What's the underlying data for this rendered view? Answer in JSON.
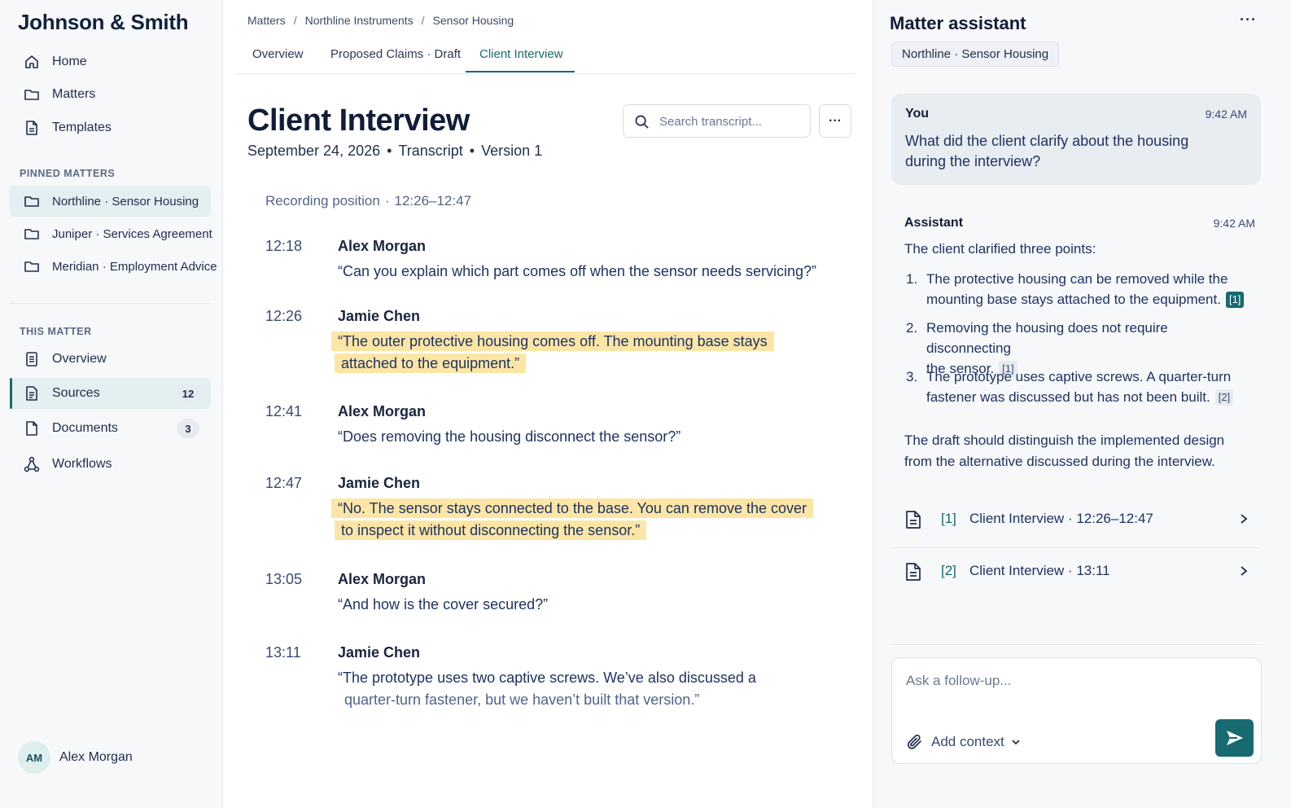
{
  "sidebar": {
    "brand": "Johnson & Smith",
    "nav": [
      {
        "label": "Home",
        "icon": "home-icon"
      },
      {
        "label": "Matters",
        "icon": "folder-icon"
      },
      {
        "label": "Templates",
        "icon": "document-icon"
      }
    ],
    "pinned_heading": "PINNED MATTERS",
    "pinned": [
      {
        "label": "Northline · Sensor Housing",
        "icon": "folder-icon",
        "selected": true
      },
      {
        "label": "Juniper · Services Agreement",
        "icon": "folder-icon"
      },
      {
        "label": "Meridian · Employment Advice",
        "icon": "folder-icon"
      }
    ],
    "matter_heading": "THIS MATTER",
    "matter_nav": [
      {
        "label": "Overview",
        "icon": "list-document-icon"
      },
      {
        "label": "Sources",
        "icon": "list-document-icon",
        "badge": "12",
        "selected": true
      },
      {
        "label": "Documents",
        "icon": "document-icon",
        "badge": "3"
      },
      {
        "label": "Workflows",
        "icon": "workflow-icon"
      }
    ],
    "user": {
      "initials": "AM",
      "name": "Alex Morgan"
    }
  },
  "main": {
    "breadcrumb": [
      "Matters",
      "Northline Instruments",
      "Sensor Housing"
    ],
    "tabs": [
      "Overview",
      "Proposed Claims · Draft",
      "Client Interview"
    ],
    "active_tab": "Client Interview",
    "title": "Client Interview",
    "meta": {
      "date": "September 24, 2026",
      "type": "Transcript",
      "version": "Version 1"
    },
    "search_placeholder": "Search transcript...",
    "more_label": "···",
    "recording_label": "Recording position",
    "recording_range": "12:26–12:47",
    "transcript": [
      {
        "time": "12:18",
        "speaker": "Alex Morgan",
        "lines": [
          "“Can you explain which part comes off when the sensor needs servicing?”"
        ],
        "highlight": false
      },
      {
        "time": "12:26",
        "speaker": "Jamie Chen",
        "lines": [
          "“The outer protective housing comes off. The mounting base stays",
          "attached to the equipment.”"
        ],
        "highlight": true
      },
      {
        "time": "12:41",
        "speaker": "Alex Morgan",
        "lines": [
          "“Does removing the housing disconnect the sensor?”"
        ],
        "highlight": false
      },
      {
        "time": "12:47",
        "speaker": "Jamie Chen",
        "lines": [
          "“No. The sensor stays connected to the base. You can remove the cover",
          "to inspect it without disconnecting the sensor.”"
        ],
        "highlight": true
      },
      {
        "time": "13:05",
        "speaker": "Alex Morgan",
        "lines": [
          "“And how is the cover secured?”"
        ],
        "highlight": false
      },
      {
        "time": "13:11",
        "speaker": "Jamie Chen",
        "lines": [
          "“The prototype uses two captive screws. We’ve also discussed a",
          "quarter-turn fastener, but we haven’t built that version.”"
        ],
        "highlight": false
      }
    ]
  },
  "assistant": {
    "title": "Matter assistant",
    "more_label": "···",
    "context_chip": "Northline · Sensor Housing",
    "user_message": {
      "author": "You",
      "time": "9:42 AM",
      "text": "What did the client clarify about the housing during the interview?"
    },
    "reply": {
      "author": "Assistant",
      "time": "9:42 AM",
      "intro": "The client clarified three points:",
      "points": [
        {
          "num": "1.",
          "line1": "The protective housing can be removed while the",
          "line2": "mounting base stays attached to the equipment.",
          "cite": "[1]",
          "cite_style": "solid"
        },
        {
          "num": "2.",
          "line1": "Removing the housing does not require disconnecting",
          "line2": "the sensor.",
          "cite": "[1]",
          "cite_style": "soft"
        },
        {
          "num": "3.",
          "line1": "The prototype uses captive screws. A quarter-turn",
          "line2": "fastener was discussed but has not been built.",
          "cite": "[2]",
          "cite_style": "soft"
        }
      ],
      "summary": "The draft should distinguish the implemented design from the alternative discussed during the interview."
    },
    "sources": [
      {
        "ref": "[1]",
        "label": "Client Interview · 12:26–12:47"
      },
      {
        "ref": "[2]",
        "label": "Client Interview · 13:11"
      }
    ],
    "composer": {
      "placeholder": "Ask a follow-up...",
      "add_context": "Add context"
    },
    "colors": {
      "accent": "#176a6f",
      "highlight": "#fbe6a6"
    }
  }
}
